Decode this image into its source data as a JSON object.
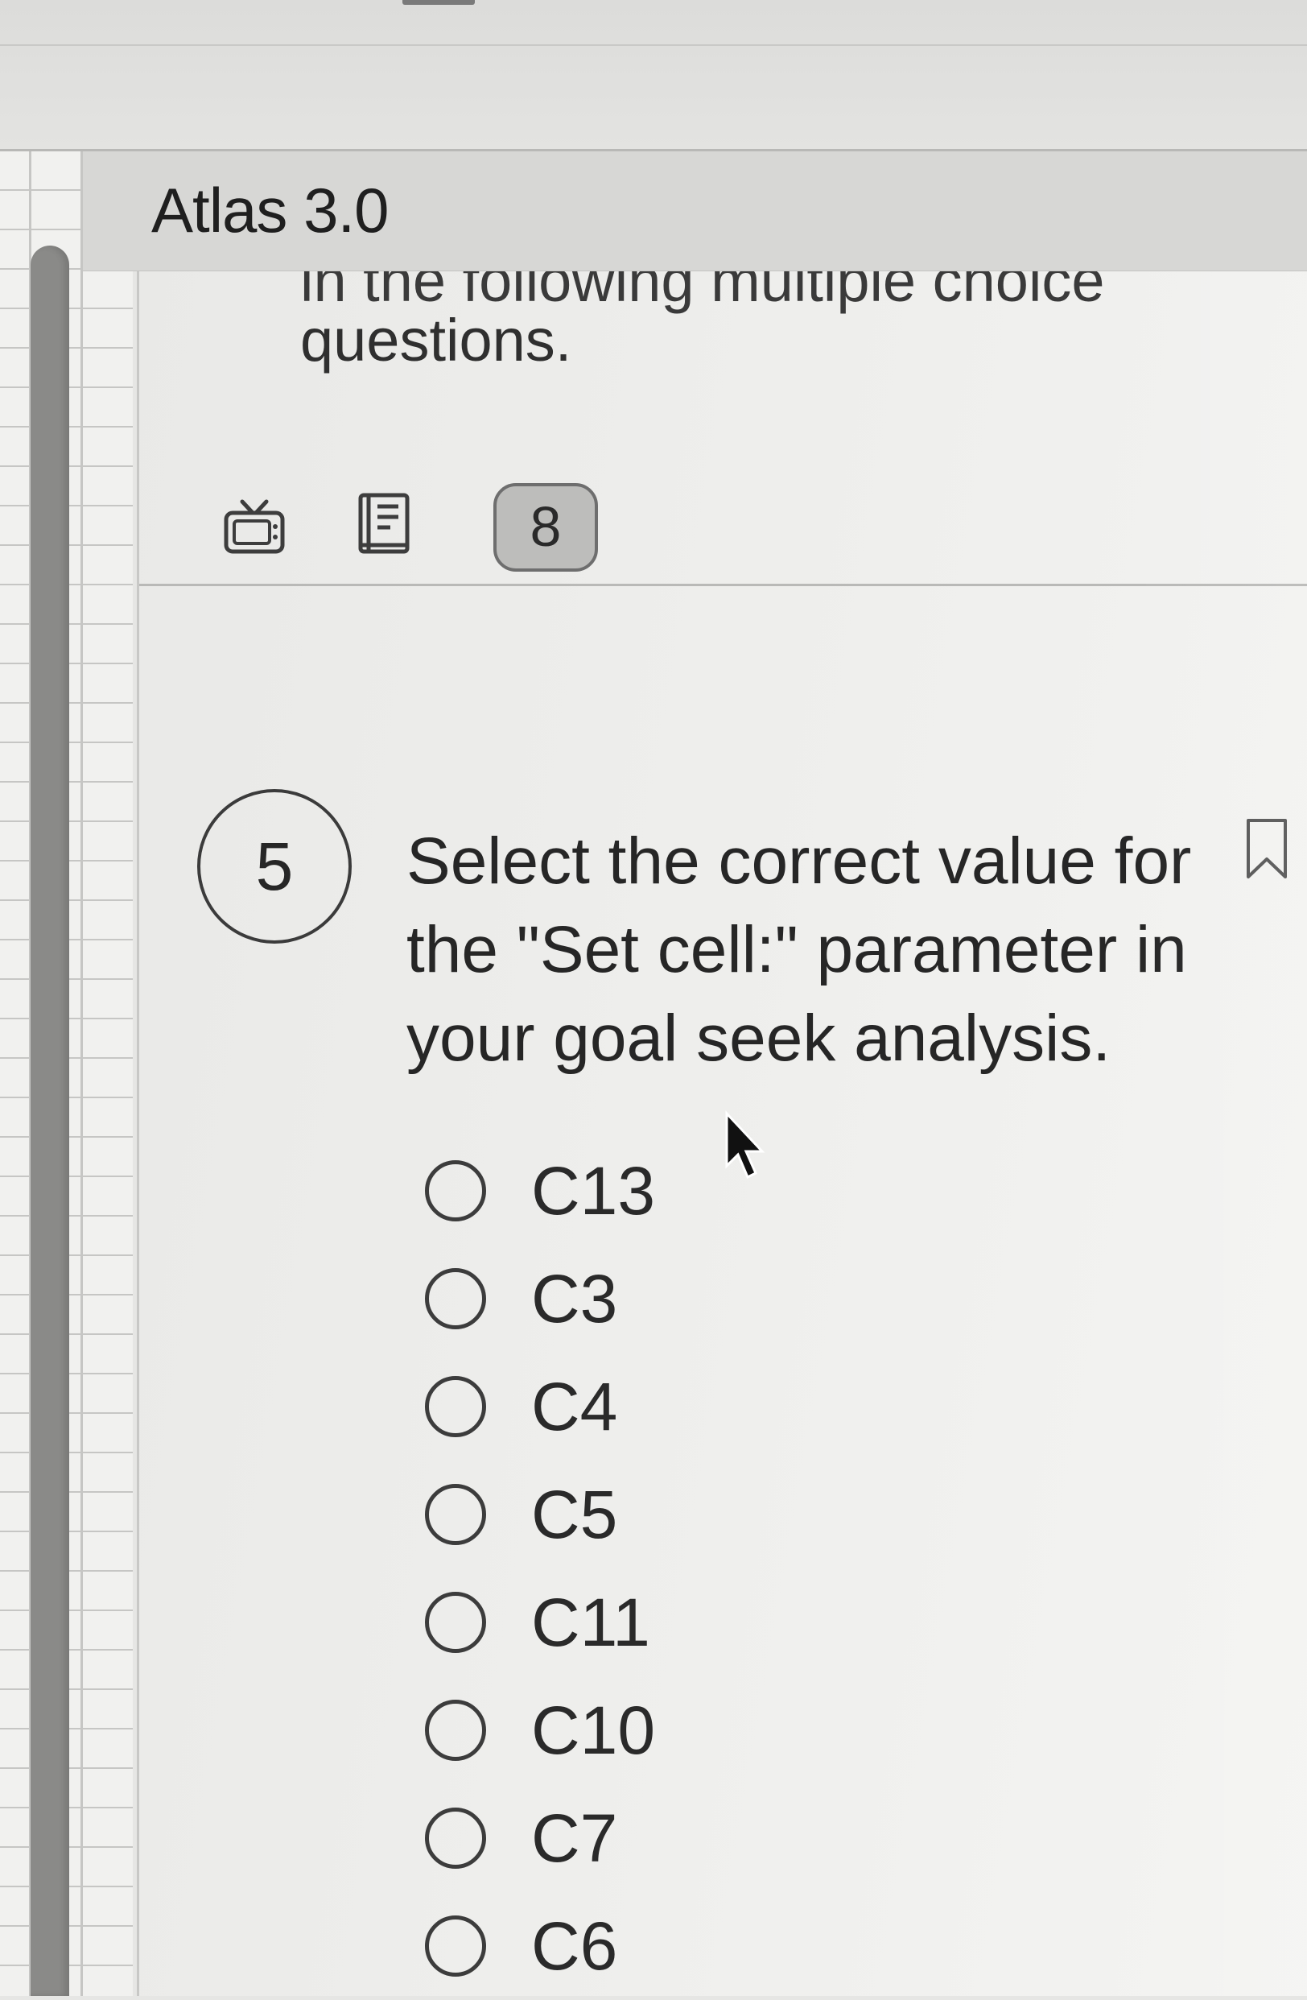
{
  "header": {
    "app_title": "Atlas 3.0"
  },
  "intro": {
    "cut_line": "in the following multiple choice",
    "last_line": "questions."
  },
  "toolbar": {
    "badge_value": "8",
    "icons": [
      "tv-icon",
      "book-icon"
    ]
  },
  "question": {
    "number": "5",
    "text": "Select the correct value for the \"Set cell:\" parameter in your goal seek analysis.",
    "options": [
      "C13",
      "C3",
      "C4",
      "C5",
      "C11",
      "C10",
      "C7",
      "C6"
    ]
  },
  "colors": {
    "text": "#262626",
    "panel_bg": "#efefed",
    "header_bg": "#d7d7d5",
    "badge_bg": "#bdbdbb"
  }
}
